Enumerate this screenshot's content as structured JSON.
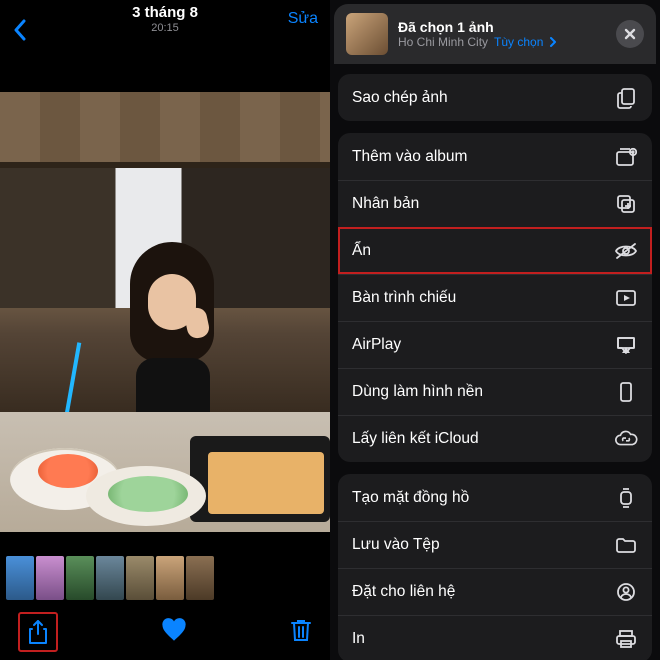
{
  "left": {
    "date": "3 tháng 8",
    "time": "20:15",
    "edit": "Sửa"
  },
  "sheet": {
    "title": "Đã chọn 1 ảnh",
    "location": "Ho Chi Minh City",
    "options": "Tùy chọn"
  },
  "actions": {
    "copy": "Sao chép ảnh",
    "addToAlbum": "Thêm vào album",
    "duplicate": "Nhân bản",
    "hide": "Ẩn",
    "slideshow": "Bàn trình chiếu",
    "airplay": "AirPlay",
    "wallpaper": "Dùng làm hình nền",
    "icloudLink": "Lấy liên kết iCloud",
    "watchFace": "Tạo mặt đồng hồ",
    "saveToFiles": "Lưu vào Tệp",
    "assignContact": "Đặt cho liên hệ",
    "print": "In"
  }
}
